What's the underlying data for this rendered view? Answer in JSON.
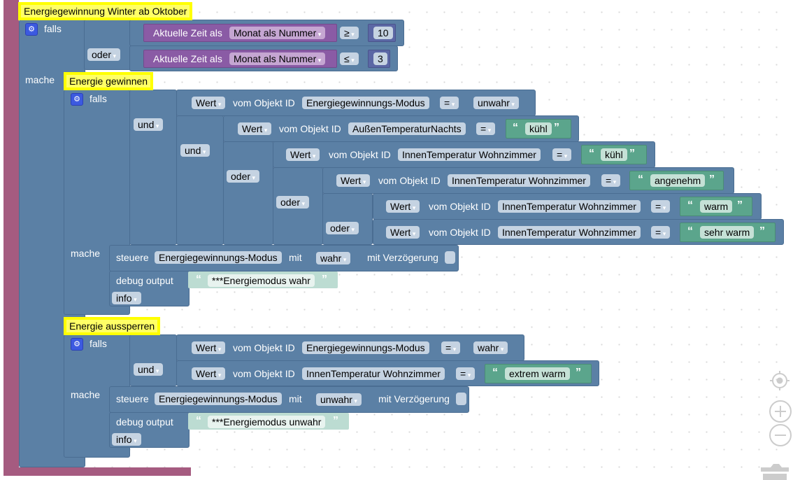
{
  "comments": {
    "outer": "Energiegewinnung Winter ab Oktober",
    "gain": "Energie gewinnen",
    "lock": "Energie aussperren"
  },
  "keywords": {
    "if": "falls",
    "do": "mache",
    "and": "und",
    "or": "oder",
    "value": "Wert",
    "from_object": "vom Objekt ID",
    "control": "steuere",
    "with": "mit",
    "with_delay": "mit Verzögerung",
    "debug": "debug output",
    "current_time_as": "Aktuelle Zeit als",
    "month_as_number": "Monat als Nummer"
  },
  "outer_if": {
    "cond1": {
      "op": "≥",
      "value": "10"
    },
    "cond2": {
      "op": "≤",
      "value": "3"
    }
  },
  "gain_block": {
    "conditions": [
      {
        "object": "Energiegewinnungs-Modus",
        "op": "=",
        "value": "unwahr",
        "type": "bool"
      },
      {
        "object": "AußenTemperaturNachts",
        "op": "=",
        "value": "kühl",
        "type": "text"
      },
      {
        "object": "InnenTemperatur Wohnzimmer",
        "op": "=",
        "value": "kühl",
        "type": "text"
      },
      {
        "object": "InnenTemperatur Wohnzimmer",
        "op": "=",
        "value": "angenehm",
        "type": "text"
      },
      {
        "object": "InnenTemperatur Wohnzimmer",
        "op": "=",
        "value": "warm",
        "type": "text"
      },
      {
        "object": "InnenTemperatur Wohnzimmer",
        "op": "=",
        "value": "sehr warm",
        "type": "text"
      }
    ],
    "action": {
      "object": "Energiegewinnungs-Modus",
      "value": "wahr"
    },
    "debug": {
      "text": "***Energiemodus wahr",
      "level": "info"
    }
  },
  "lock_block": {
    "conditions": [
      {
        "object": "Energiegewinnungs-Modus",
        "op": "=",
        "value": "wahr",
        "type": "bool"
      },
      {
        "object": "InnenTemperatur Wohnzimmer",
        "op": "=",
        "value": "extrem warm",
        "type": "text"
      }
    ],
    "action": {
      "object": "Energiegewinnungs-Modus",
      "value": "unwahr"
    },
    "debug": {
      "text": "***Energiemodus unwahr",
      "level": "info"
    }
  },
  "workspace_controls": [
    "recenter-icon",
    "zoom-in-icon",
    "zoom-out-icon",
    "trash-icon"
  ],
  "colors": {
    "block_blue": "#5b80a5",
    "block_pink": "#a55b80",
    "block_purple": "#8a5ba5",
    "block_green": "#5ba58c",
    "comment_yellow": "#ffff66"
  }
}
